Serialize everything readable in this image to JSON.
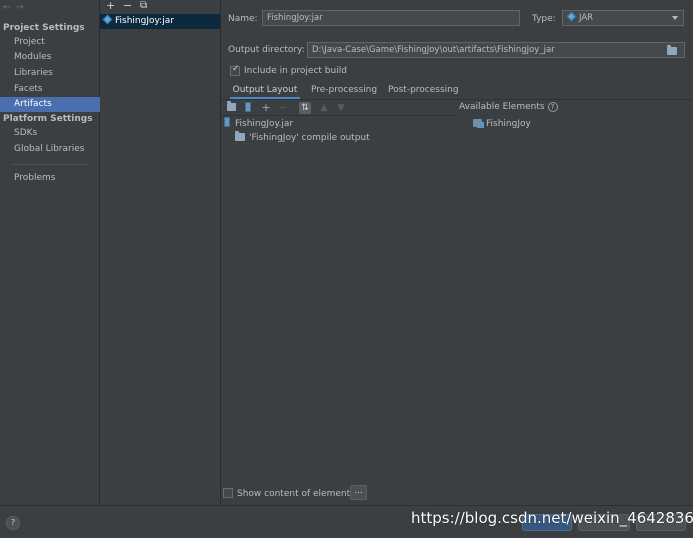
{
  "nav": {
    "back": "←",
    "forward": "→"
  },
  "sidebar": {
    "project_settings_title": "Project Settings",
    "project_items": [
      "Project",
      "Modules",
      "Libraries",
      "Facets",
      "Artifacts"
    ],
    "selected_item": "Artifacts",
    "platform_settings_title": "Platform Settings",
    "platform_items": [
      "SDKs",
      "Global Libraries"
    ],
    "problems": "Problems"
  },
  "artifacts_panel": {
    "toolbar": {
      "add": "+",
      "remove": "−",
      "copy": "⧉"
    },
    "items": [
      "FishingJoy:jar"
    ]
  },
  "form": {
    "name_label": "Name:",
    "name_value": "FishingJoy:jar",
    "type_label": "Type:",
    "type_value": "JAR",
    "output_dir_label": "Output directory:",
    "output_dir_value": "D:\\Java-Case\\Game\\FishingJoy\\out\\artifacts\\FishingJoy_jar",
    "include_in_build_label": "Include in project build",
    "include_in_build_checked": true
  },
  "tabs": [
    "Output Layout",
    "Pre-processing",
    "Post-processing"
  ],
  "active_tab": "Output Layout",
  "layout_toolbar": {
    "icons": [
      "new-folder-icon",
      "jar-icon",
      "add-icon",
      "remove-icon",
      "sort-icon",
      "move-up-icon",
      "move-down-icon"
    ]
  },
  "output_tree": {
    "root": "FishingJoy.jar",
    "children": [
      "'FishingJoy' compile output"
    ]
  },
  "available_elements": {
    "title": "Available Elements",
    "help": "?",
    "items": [
      "FishingJoy"
    ]
  },
  "show_content": {
    "label": "Show content of elements",
    "checked": false,
    "more_button": "..."
  },
  "bottom": {
    "help": "?",
    "watermark": "https://blog.csdn.net/weixin_46428363"
  },
  "colors": {
    "background": "#3c3f41",
    "selection": "#4b6eaf",
    "list_selection": "#0d293e",
    "accent": "#4a88c7"
  }
}
